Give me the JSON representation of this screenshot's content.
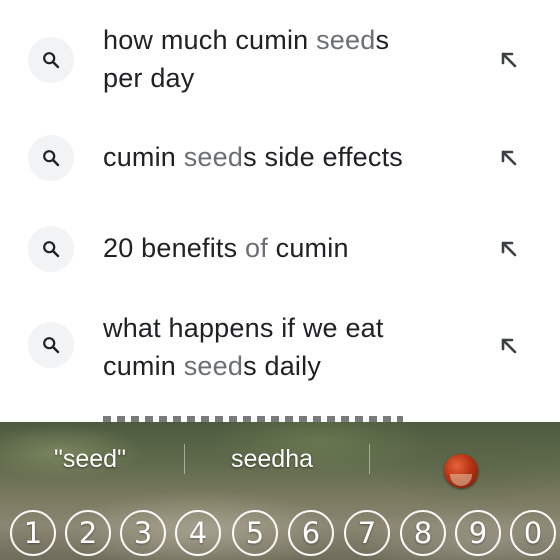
{
  "suggestions": [
    {
      "lines": [
        [
          [
            "how much cumin ",
            false
          ],
          [
            "seed",
            true
          ],
          [
            "s",
            false
          ]
        ],
        [
          [
            "per day",
            false
          ]
        ]
      ]
    },
    {
      "lines": [
        [
          [
            "cumin ",
            false
          ],
          [
            "seed",
            true
          ],
          [
            "s side effects",
            false
          ]
        ]
      ]
    },
    {
      "lines": [
        [
          [
            "20 benefits ",
            false
          ],
          [
            "of",
            true
          ],
          [
            " cumin",
            false
          ]
        ]
      ]
    },
    {
      "lines": [
        [
          [
            "what happens if we eat",
            false
          ]
        ],
        [
          [
            "cumin ",
            false
          ],
          [
            "seed",
            true
          ],
          [
            "s daily",
            false
          ]
        ]
      ]
    }
  ],
  "icons": {
    "search": "search-icon",
    "fill_query": "arrow-up-left-icon"
  },
  "keyboard": {
    "suggestion_1": "\"seed\"",
    "suggestion_2": "seedha",
    "emoji_suggestion": "chestnut-emoji",
    "number_keys": [
      "1",
      "2",
      "3",
      "4",
      "5",
      "6",
      "7",
      "8",
      "9",
      "0"
    ]
  },
  "colors": {
    "text": "#202124",
    "highlight": "#6b6f74",
    "badge_bg": "#f1f3f4"
  }
}
